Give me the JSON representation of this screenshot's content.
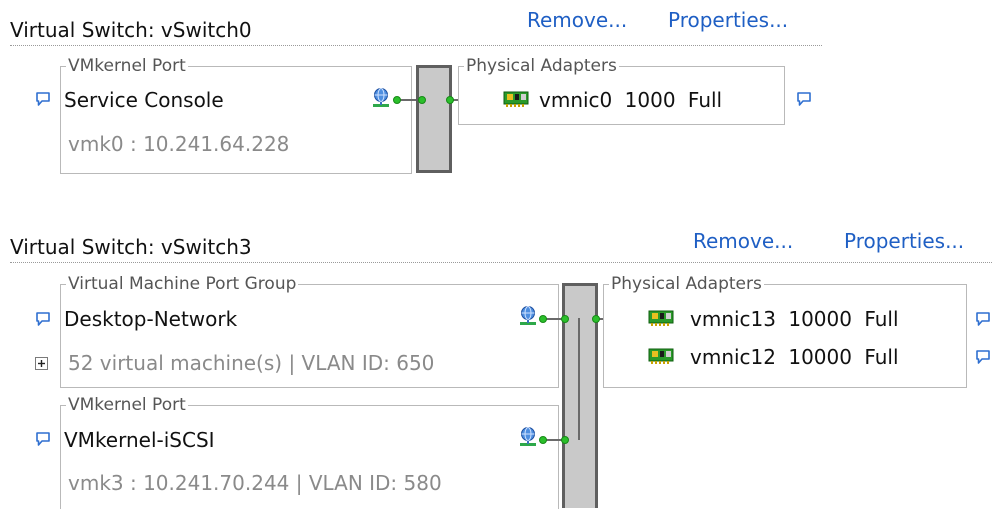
{
  "vswitch0": {
    "title": "Virtual Switch: vSwitch0",
    "remove_label": "Remove...",
    "properties_label": "Properties...",
    "port_group": {
      "legend": "VMkernel Port",
      "name": "Service Console",
      "detail": "vmk0 : 10.241.64.228"
    },
    "physical_adapters": {
      "legend": "Physical Adapters",
      "items": [
        {
          "name": "vmnic0",
          "speed": "1000",
          "duplex": "Full"
        }
      ]
    }
  },
  "vswitch3": {
    "title": "Virtual Switch: vSwitch3",
    "remove_label": "Remove...",
    "properties_label": "Properties...",
    "vm_port_group": {
      "legend": "Virtual Machine Port Group",
      "name": "Desktop-Network",
      "detail": "52 virtual machine(s) | VLAN ID: 650"
    },
    "vmkernel_port": {
      "legend": "VMkernel Port",
      "name": "VMkernel-iSCSI",
      "detail": "vmk3 : 10.241.70.244 | VLAN ID: 580"
    },
    "physical_adapters": {
      "legend": "Physical Adapters",
      "items": [
        {
          "name": "vmnic13",
          "speed": "10000",
          "duplex": "Full"
        },
        {
          "name": "vmnic12",
          "speed": "10000",
          "duplex": "Full"
        }
      ]
    }
  },
  "colors": {
    "link": "#1f5fc4",
    "connector_dot": "#2bbf2b",
    "bus_fill": "#c9c9c9"
  }
}
